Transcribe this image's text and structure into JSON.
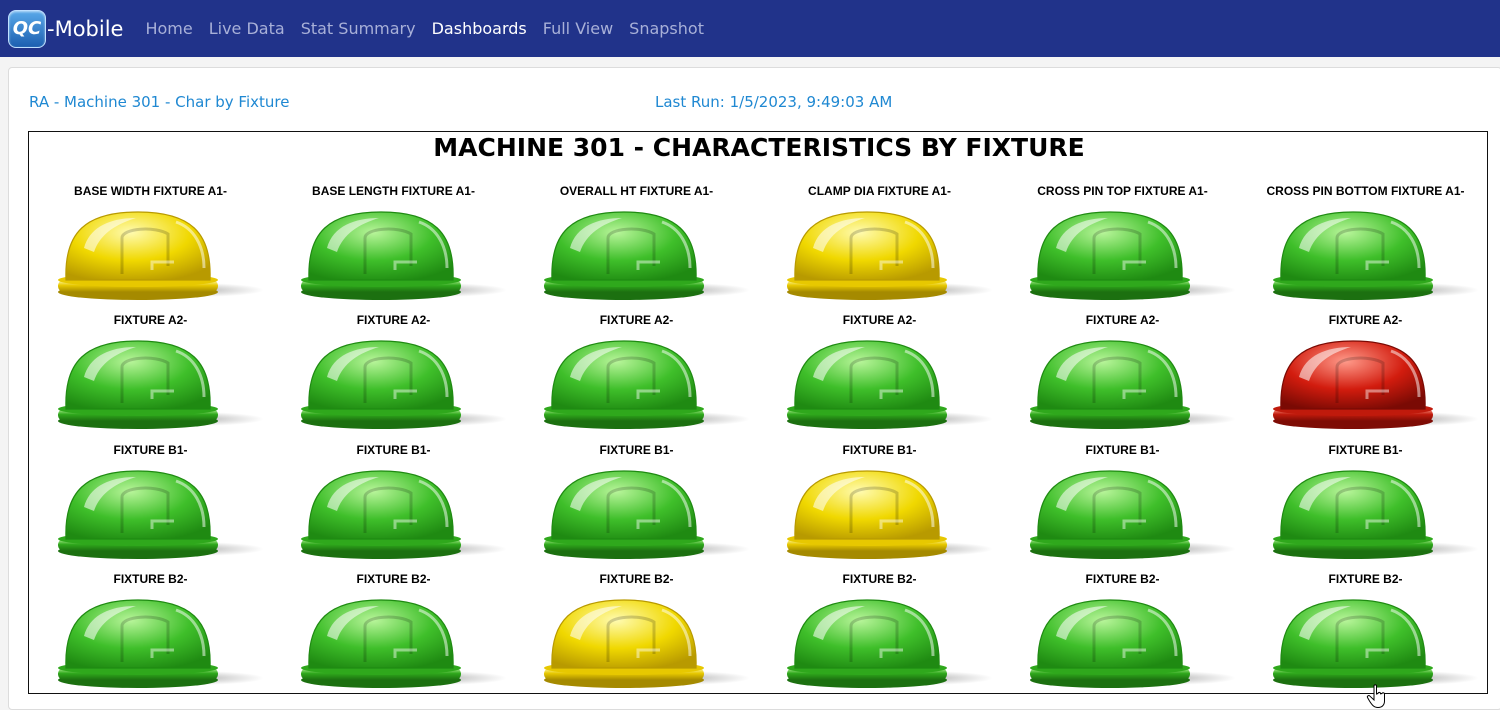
{
  "navbar": {
    "logo_badge": "QC",
    "logo_text": "-Mobile",
    "links": [
      "Home",
      "Live Data",
      "Stat Summary",
      "Dashboards",
      "Full View",
      "Snapshot"
    ],
    "active": "Dashboards"
  },
  "header": {
    "dashboard_name": "RA - Machine 301 - Char by Fixture",
    "last_run": "Last Run: 1/5/2023, 9:49:03 AM"
  },
  "board": {
    "title": "MACHINE 301 - CHARACTERISTICS BY FIXTURE",
    "rows": [
      {
        "labels": [
          "BASE WIDTH FIXTURE A1-",
          "BASE LENGTH FIXTURE A1-",
          "OVERALL HT FIXTURE A1-",
          "CLAMP DIA FIXTURE A1-",
          "CROSS PIN TOP FIXTURE A1-",
          "CROSS PIN BOTTOM FIXTURE A1-"
        ],
        "status": [
          "yellow",
          "green",
          "green",
          "yellow",
          "green",
          "green"
        ]
      },
      {
        "labels": [
          "FIXTURE A2-",
          "FIXTURE A2-",
          "FIXTURE A2-",
          "FIXTURE A2-",
          "FIXTURE A2-",
          "FIXTURE A2-"
        ],
        "status": [
          "green",
          "green",
          "green",
          "green",
          "green",
          "red"
        ]
      },
      {
        "labels": [
          "FIXTURE B1-",
          "FIXTURE B1-",
          "FIXTURE B1-",
          "FIXTURE B1-",
          "FIXTURE B1-",
          "FIXTURE B1-"
        ],
        "status": [
          "green",
          "green",
          "green",
          "yellow",
          "green",
          "green"
        ]
      },
      {
        "labels": [
          "FIXTURE B2-",
          "FIXTURE B2-",
          "FIXTURE B2-",
          "FIXTURE B2-",
          "FIXTURE B2-",
          "FIXTURE B2-"
        ],
        "status": [
          "green",
          "green",
          "yellow",
          "green",
          "green",
          "green"
        ]
      }
    ]
  },
  "colors": {
    "navbar": "#21338a",
    "link_text": "#1f88d2",
    "green": "#3fbf2a",
    "yellow": "#f0d800",
    "red": "#d21c0e"
  }
}
